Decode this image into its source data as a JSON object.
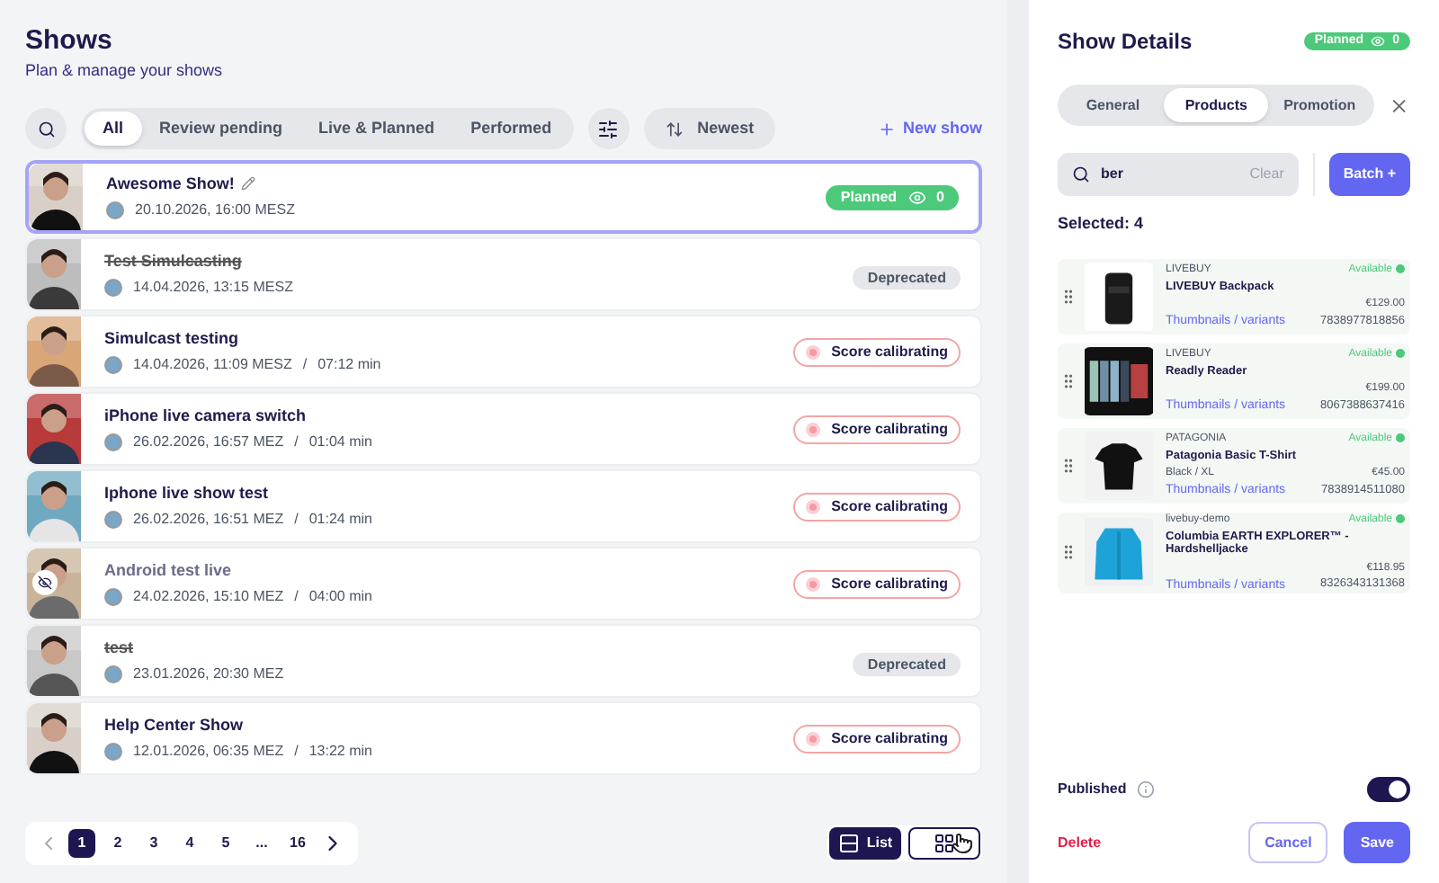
{
  "header": {
    "title": "Shows",
    "subtitle": "Plan & manage your shows"
  },
  "filters": [
    {
      "label": "All",
      "selected": true
    },
    {
      "label": "Review pending",
      "selected": false
    },
    {
      "label": "Live & Planned",
      "selected": false
    },
    {
      "label": "Performed",
      "selected": false
    }
  ],
  "sort": {
    "label": "Newest"
  },
  "new_show": {
    "label": "New show"
  },
  "shows": [
    {
      "title": "Awesome Show!",
      "edit": true,
      "date": "20.10.2026, 16:00 MESZ",
      "status": {
        "kind": "planned",
        "label": "Planned",
        "viewers": "0"
      },
      "selected": true,
      "struck": false,
      "hidden": false
    },
    {
      "title": "Test Simulcasting",
      "edit": false,
      "date": "14.04.2026, 13:15 MESZ",
      "status": {
        "kind": "deprecated",
        "label": "Deprecated"
      },
      "selected": false,
      "struck": true,
      "hidden": false
    },
    {
      "title": "Simulcast testing",
      "edit": false,
      "date": "14.04.2026, 11:09 MESZ",
      "separator": "/",
      "duration": "07:12 min",
      "status": {
        "kind": "calibrating",
        "label": "Score calibrating"
      },
      "selected": false,
      "struck": false,
      "hidden": false
    },
    {
      "title": "iPhone live camera switch",
      "edit": false,
      "date": "26.02.2026, 16:57 MEZ",
      "separator": "/",
      "duration": "01:04 min",
      "status": {
        "kind": "calibrating",
        "label": "Score calibrating"
      },
      "selected": false,
      "struck": false,
      "hidden": false
    },
    {
      "title": "Iphone live show test",
      "edit": false,
      "date": "26.02.2026, 16:51 MEZ",
      "separator": "/",
      "duration": "01:24 min",
      "status": {
        "kind": "calibrating",
        "label": "Score calibrating"
      },
      "selected": false,
      "struck": false,
      "hidden": false
    },
    {
      "title": "Android test live",
      "edit": false,
      "date": "24.02.2026, 15:10 MEZ",
      "separator": "/",
      "duration": "04:00 min",
      "status": {
        "kind": "calibrating",
        "label": "Score calibrating"
      },
      "selected": false,
      "struck": false,
      "hidden": true
    },
    {
      "title": "test",
      "edit": false,
      "date": "23.01.2026, 20:30 MEZ",
      "status": {
        "kind": "deprecated",
        "label": "Deprecated"
      },
      "selected": false,
      "struck": true,
      "hidden": false
    },
    {
      "title": "Help Center Show",
      "edit": false,
      "date": "12.01.2026, 06:35 MEZ",
      "separator": "/",
      "duration": "13:22 min",
      "status": {
        "kind": "calibrating",
        "label": "Score calibrating"
      },
      "selected": false,
      "struck": false,
      "hidden": false
    }
  ],
  "pagination": {
    "pages": [
      {
        "label": "1",
        "selected": true
      },
      {
        "label": "2",
        "selected": false
      },
      {
        "label": "3",
        "selected": false
      },
      {
        "label": "4",
        "selected": false
      },
      {
        "label": "5",
        "selected": false
      },
      {
        "label": "...",
        "selected": false
      },
      {
        "label": "16",
        "selected": false
      }
    ]
  },
  "views": [
    {
      "kind": "list",
      "label": "List",
      "selected": true
    },
    {
      "kind": "grid",
      "selected": false
    }
  ],
  "details": {
    "title": "Show Details",
    "status": {
      "label": "Planned",
      "viewers": "0"
    },
    "tabs": [
      {
        "label": "General",
        "selected": false
      },
      {
        "label": "Products",
        "selected": true
      },
      {
        "label": "Promotion",
        "selected": false
      }
    ],
    "search": {
      "value": "ber",
      "clear": "Clear"
    },
    "batch": "Batch +",
    "selected_count": "Selected: 4",
    "products": [
      {
        "kind": "backpack",
        "brand": "LIVEBUY",
        "name": "LIVEBUY Backpack",
        "availability": "Available",
        "price": "€129.00",
        "link": "Thumbnails / variants",
        "sku": "7838977818856"
      },
      {
        "kind": "reader",
        "brand": "LIVEBUY",
        "name": "Readly Reader",
        "availability": "Available",
        "price": "€199.00",
        "link": "Thumbnails / variants",
        "sku": "8067388637416"
      },
      {
        "kind": "shirt",
        "brand": "PATAGONIA",
        "name": "Patagonia Basic T-Shirt",
        "variant": "Black / XL",
        "availability": "Available",
        "price": "€45.00",
        "link": "Thumbnails / variants",
        "sku": "7838914511080"
      },
      {
        "kind": "jacket",
        "brand": "livebuy-demo",
        "name": "Columbia EARTH EXPLORER™ - Hardshelljacke",
        "availability": "Available",
        "price": "€118.95",
        "link": "Thumbnails / variants",
        "sku": "8326343131368"
      }
    ],
    "published": {
      "label": "Published",
      "on": true
    },
    "delete": "Delete",
    "cancel": "Cancel",
    "save": "Save"
  }
}
